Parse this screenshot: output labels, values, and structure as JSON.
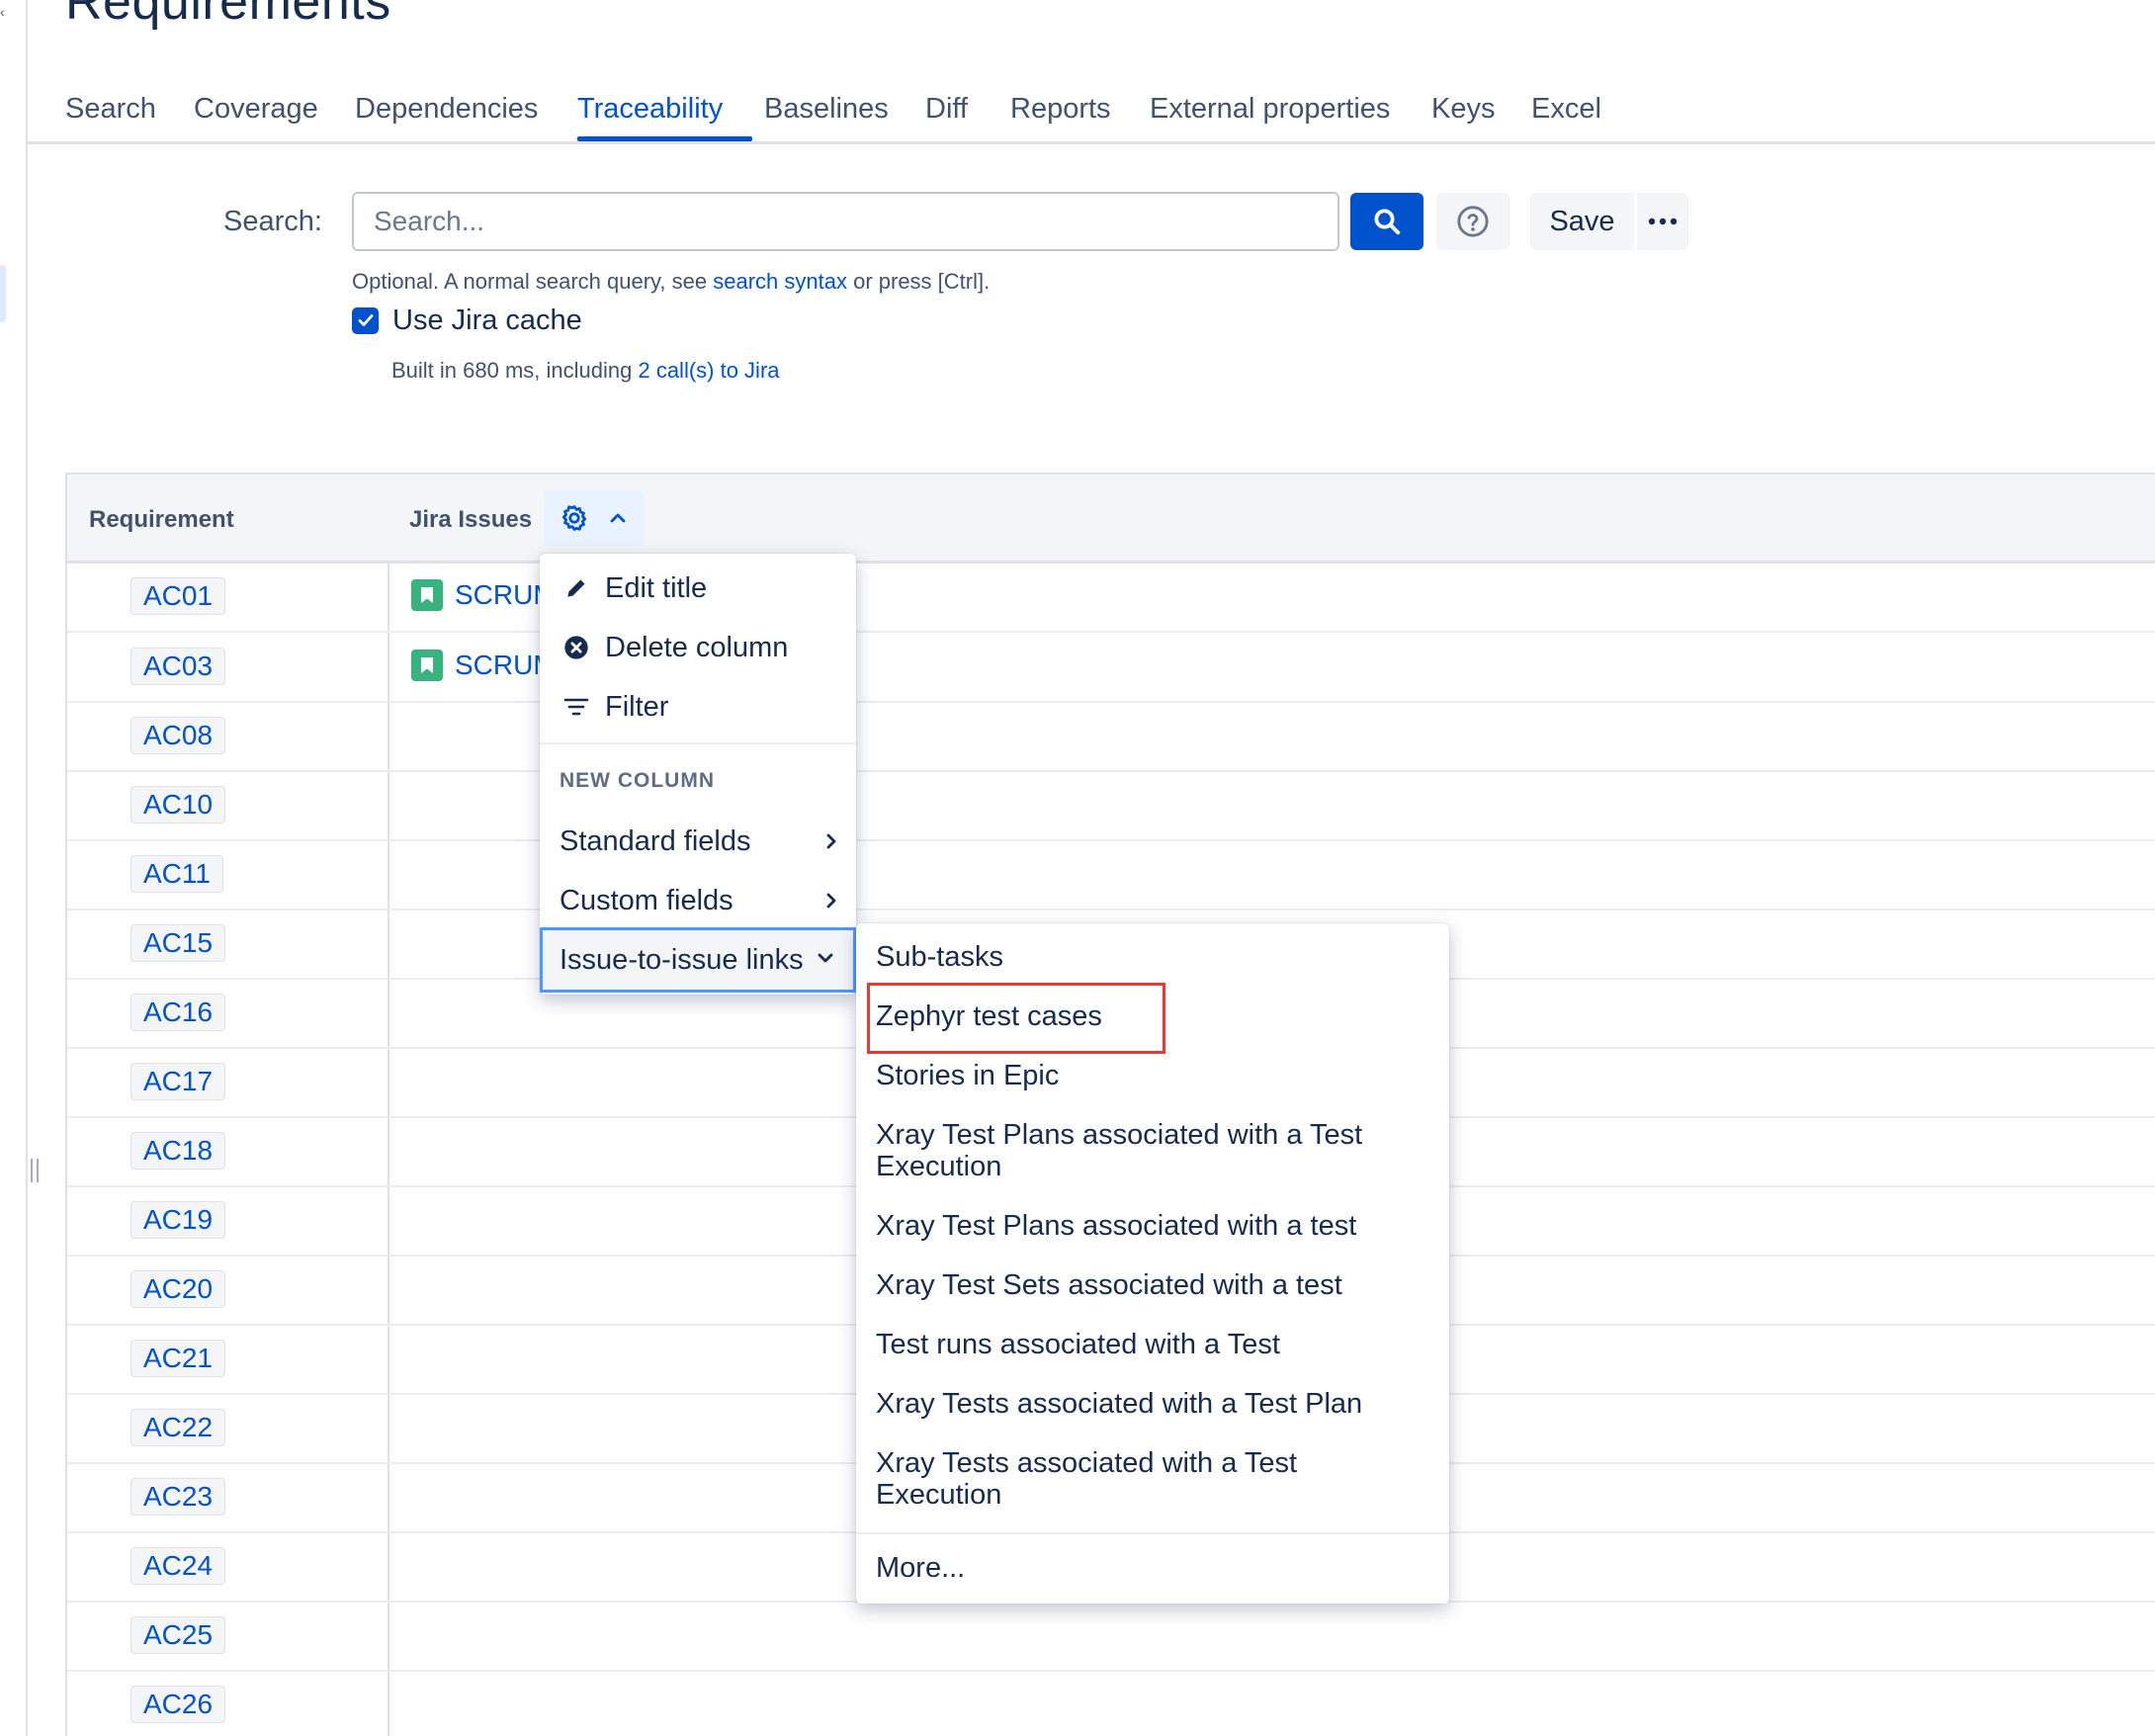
{
  "page": {
    "title": "Requirements"
  },
  "tabs": [
    {
      "label": "Search"
    },
    {
      "label": "Coverage"
    },
    {
      "label": "Dependencies"
    },
    {
      "label": "Traceability",
      "active": true
    },
    {
      "label": "Baselines"
    },
    {
      "label": "Diff"
    },
    {
      "label": "Reports"
    },
    {
      "label": "External properties"
    },
    {
      "label": "Keys"
    },
    {
      "label": "Excel"
    }
  ],
  "search": {
    "label": "Search:",
    "placeholder": "Search...",
    "value": "",
    "save_label": "Save",
    "search_button_icon": "magnifier-icon",
    "help_button_icon": "question-circle-icon",
    "more_button_icon": "ellipsis-icon"
  },
  "hint": {
    "prefix": "Optional. A normal search query, see ",
    "link": "search syntax",
    "suffix": " or press [Ctrl]."
  },
  "cache": {
    "label": "Use Jira cache",
    "checked": true
  },
  "built": {
    "prefix": "Built in 680 ms, including ",
    "link": "2 call(s) to Jira"
  },
  "table": {
    "columns": [
      "Requirement",
      "Jira Issues"
    ],
    "rows": [
      {
        "key": "AC01",
        "issue": "SCRUM"
      },
      {
        "key": "AC03",
        "issue": "SCRUM"
      },
      {
        "key": "AC08",
        "issue": ""
      },
      {
        "key": "AC10",
        "issue": ""
      },
      {
        "key": "AC11",
        "issue": ""
      },
      {
        "key": "AC15",
        "issue": ""
      },
      {
        "key": "AC16",
        "issue": ""
      },
      {
        "key": "AC17",
        "issue": ""
      },
      {
        "key": "AC18",
        "issue": ""
      },
      {
        "key": "AC19",
        "issue": ""
      },
      {
        "key": "AC20",
        "issue": ""
      },
      {
        "key": "AC21",
        "issue": ""
      },
      {
        "key": "AC22",
        "issue": ""
      },
      {
        "key": "AC23",
        "issue": ""
      },
      {
        "key": "AC24",
        "issue": ""
      },
      {
        "key": "AC25",
        "issue": ""
      },
      {
        "key": "AC26",
        "issue": ""
      }
    ]
  },
  "column_menu": {
    "items": [
      {
        "label": "Edit title",
        "icon": "pencil-icon"
      },
      {
        "label": "Delete column",
        "icon": "close-circle-icon"
      },
      {
        "label": "Filter",
        "icon": "filter-icon"
      }
    ],
    "section_title": "NEW COLUMN",
    "submenus": [
      {
        "label": "Standard fields"
      },
      {
        "label": "Custom fields"
      },
      {
        "label": "Issue-to-issue links",
        "expanded": true
      }
    ]
  },
  "links_submenu": {
    "items": [
      "Sub-tasks",
      "Zephyr test cases",
      "Stories in Epic",
      "Xray Test Plans associated with a Test Execution",
      "Xray Test Plans associated with a test",
      "Xray Test Sets associated with a test",
      "Test runs associated with a Test",
      "Xray Tests associated with a Test Plan",
      "Xray Tests associated with a Test Execution"
    ],
    "more": "More...",
    "highlighted": "Zephyr test cases"
  },
  "colors": {
    "accent": "#0052cc",
    "story": "#36b37e",
    "highlight": "#e53935"
  }
}
